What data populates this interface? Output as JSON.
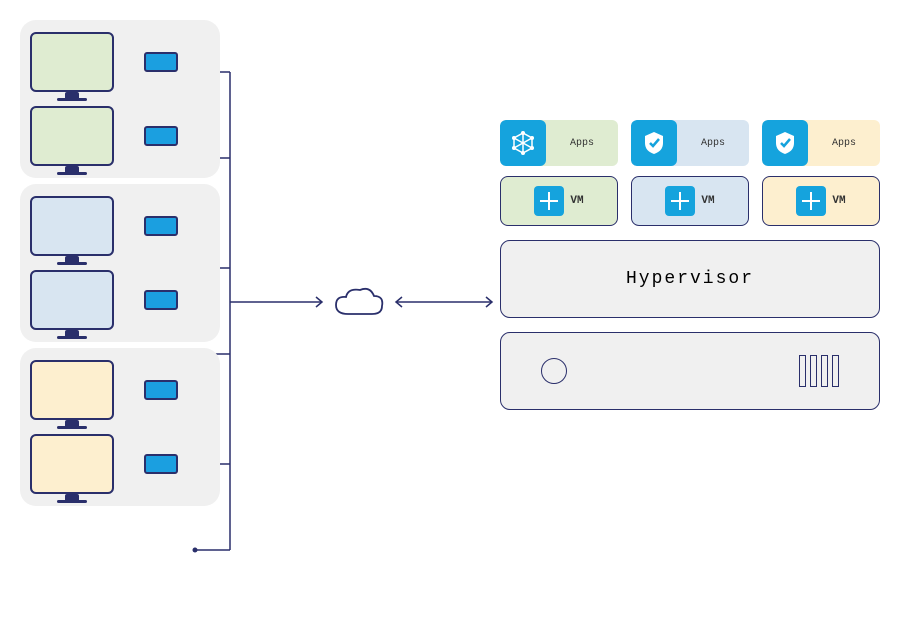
{
  "clients": {
    "groups": [
      {
        "color": "green",
        "count": 2
      },
      {
        "color": "blue",
        "count": 2
      },
      {
        "color": "cream",
        "count": 2
      }
    ]
  },
  "cloud": {
    "name": "cloud"
  },
  "apps": [
    {
      "color": "green",
      "icon": "integration",
      "label": "Apps"
    },
    {
      "color": "blue",
      "icon": "shield-check",
      "label": "Apps"
    },
    {
      "color": "cream",
      "icon": "shield-check",
      "label": "Apps"
    }
  ],
  "vms": [
    {
      "color": "green",
      "os": "windows",
      "label": "VM"
    },
    {
      "color": "blue",
      "os": "windows",
      "label": "VM"
    },
    {
      "color": "cream",
      "os": "windows",
      "label": "VM"
    }
  ],
  "hypervisor": {
    "label": "Hypervisor"
  },
  "server": {
    "name": "physical-server"
  }
}
